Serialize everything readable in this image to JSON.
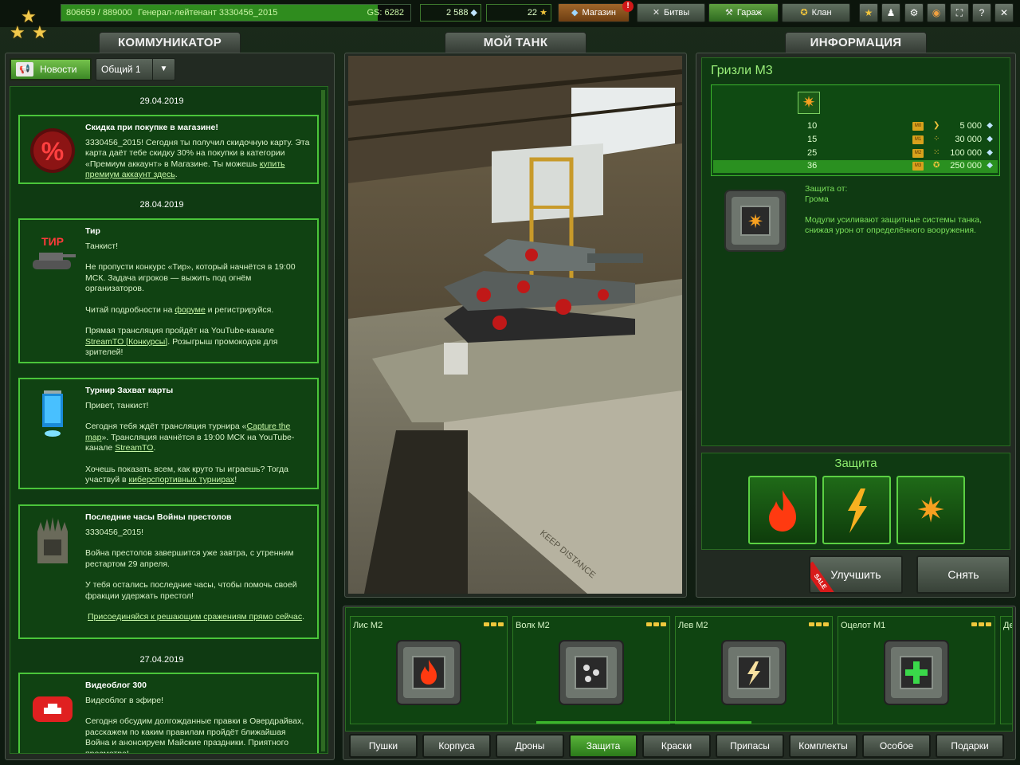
{
  "topbar": {
    "xp_text": "806659 / 889000",
    "xp_fraction": 0.907,
    "rank_name": "Генерал-лейтенант 3330456_2015",
    "gear_score": "GS: 6282",
    "crystals": "2 588",
    "tankoins": "22",
    "shop_label": "Магазин",
    "shop_badge": "!",
    "battles_label": "Битвы",
    "garage_label": "Гараж",
    "clan_label": "Клан"
  },
  "panels": {
    "left_title": "КОММУНИКАТОР",
    "center_title": "МОЙ ТАНК",
    "right_title": "ИНФОРМАЦИЯ"
  },
  "communicator": {
    "news_tab": "Новости",
    "channel": "Общий 1",
    "dates": [
      "29.04.2019",
      "28.04.2019",
      "27.04.2019"
    ],
    "items": [
      {
        "title": "Скидка при покупке в магазине!",
        "body": "3330456_2015! Сегодня ты получил скидочную карту. Эта карта даёт тебе скидку 30% на покупки в категории «Премиум аккаунт» в Магазине. Ты можешь ",
        "link": "купить премиум аккаунт здесь",
        "tail": "."
      },
      {
        "title": "Тир",
        "p1": "Танкист!",
        "p2": "Не пропусти конкурс «Тир», который начнётся в 19:00 МСК. Задача игроков — выжить под огнём организаторов.",
        "p3a": "Читай подробности на ",
        "p3link": "форуме",
        "p3b": " и регистрируйся.",
        "p4a": "Прямая трансляция пройдёт на YouTube-канале ",
        "p4link": "StreamTO [Конкурсы]",
        "p4b": ". Розыгрыш промокодов для зрителей!",
        "thumb_text": "ТИР"
      },
      {
        "title": "Турнир Захват карты",
        "p1": "Привет, танкист!",
        "p2a": " Сегодня тебя ждёт трансляция турнира «",
        "p2link": "Capture the map",
        "p2b": "». Трансляция начнётся в 19:00 МСК на YouTube-канале ",
        "p2link2": "StreamTO",
        "p2c": ".",
        "p3a": "Хочешь показать всем, как круто ты играешь? Тогда участвуй в ",
        "p3link": "киберспортивных турнирах",
        "p3b": "!"
      },
      {
        "title": "Последние часы Войны престолов",
        "p1": "3330456_2015!",
        "p2": "Война престолов завершится уже завтра, с утренним рестартом 29 апреля.",
        "p3": "У тебя остались последние часы, чтобы помочь своей фракции удержать престол!",
        "p4link": "Присоединяйся к решающим сражениям прямо сейчас",
        "p4b": "."
      },
      {
        "title": "Видеоблог 300",
        "p1": "Видеоблог в эфире!",
        "p2": "Сегодня обсудим долгожданные правки в Овердрайвах, расскажем по каким правилам пройдёт ближайшая Война и анонсируем Майские праздники. Приятного  просмотра!"
      }
    ]
  },
  "info": {
    "item_name": "Гризли M3",
    "upgrades": [
      {
        "level": "10",
        "mark": "M0",
        "price": "5 000"
      },
      {
        "level": "15",
        "mark": "M1",
        "price": "30 000"
      },
      {
        "level": "25",
        "mark": "M2",
        "price": "100 000"
      },
      {
        "level": "36",
        "mark": "M3",
        "price": "250 000"
      }
    ],
    "protection_from_label": "Защита от:",
    "protection_from_value": "Грома",
    "description": "Модули усиливают защитные системы танка, снижая урон от определённого вооружения.",
    "slots_title": "Защита",
    "upgrade_button": "Улучшить",
    "sale_badge": "SALE",
    "remove_button": "Снять"
  },
  "modules": [
    {
      "name": "Лис M2",
      "icon": "flame-icon"
    },
    {
      "name": "Волк M2",
      "icon": "dots-icon"
    },
    {
      "name": "Лев M2",
      "icon": "lightning-icon"
    },
    {
      "name": "Оцелот M1",
      "icon": "plus-icon"
    },
    {
      "name": "Де",
      "icon": "module-icon"
    }
  ],
  "categories": [
    "Пушки",
    "Корпуса",
    "Дроны",
    "Защита",
    "Краски",
    "Припасы",
    "Комплекты",
    "Особое",
    "Подарки"
  ],
  "active_category": "Защита",
  "colors": {
    "accent": "#3bb52d",
    "background": "#0f3a12",
    "gold": "#f0c43c",
    "alert": "#d01818"
  }
}
